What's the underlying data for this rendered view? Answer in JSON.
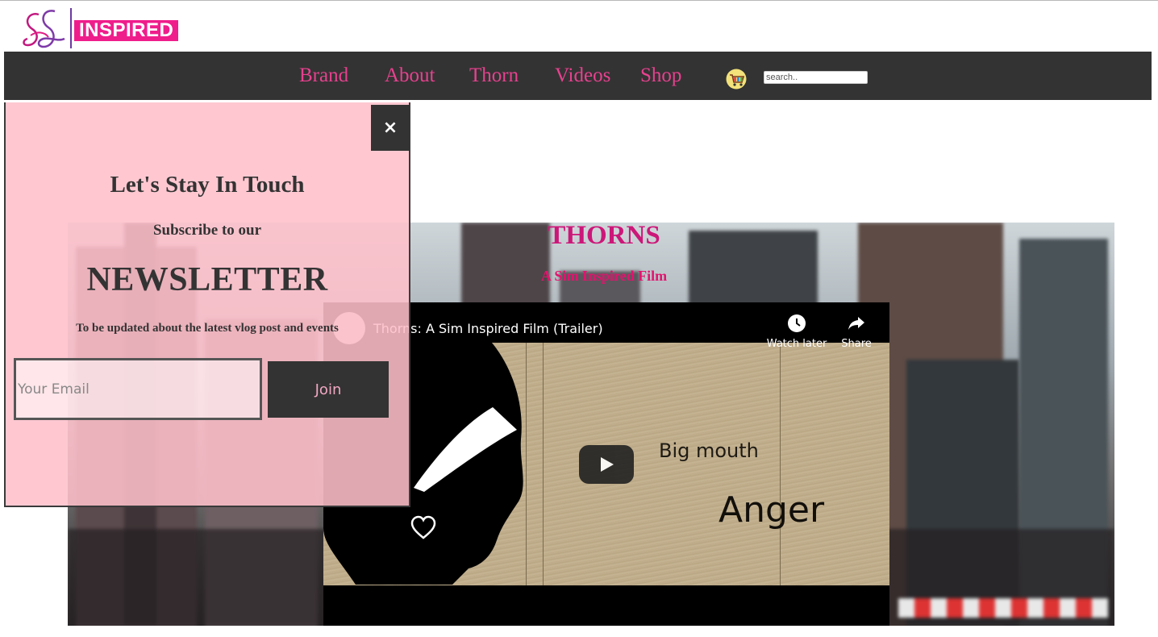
{
  "logo": {
    "word": "INSPIRED"
  },
  "nav": {
    "items": [
      "Brand",
      "About",
      "Thorn",
      "Videos",
      "Shop"
    ],
    "search_placeholder": "search..",
    "cart_icon": "shopping-cart-icon"
  },
  "hero": {
    "title": "THORNS",
    "subtitle": "A Sim Inspired Film"
  },
  "video": {
    "title": "Thorns: A Sim Inspired Film (Trailer)",
    "watch_later": "Watch later",
    "share": "Share",
    "caption_1": "Big mouth",
    "caption_2": "Anger"
  },
  "popup": {
    "close": "×",
    "heading": "Let's Stay In Touch",
    "subheading": "Subscribe to our",
    "big": "NEWSLETTER",
    "description": "To be updated about the latest vlog post and events",
    "email_placeholder": "Your Email",
    "join": "Join"
  },
  "colors": {
    "accent": "#e8418f",
    "nav_bg": "#333333",
    "popup_bg": "#ffc0cb",
    "hero_title": "#cc1779"
  }
}
